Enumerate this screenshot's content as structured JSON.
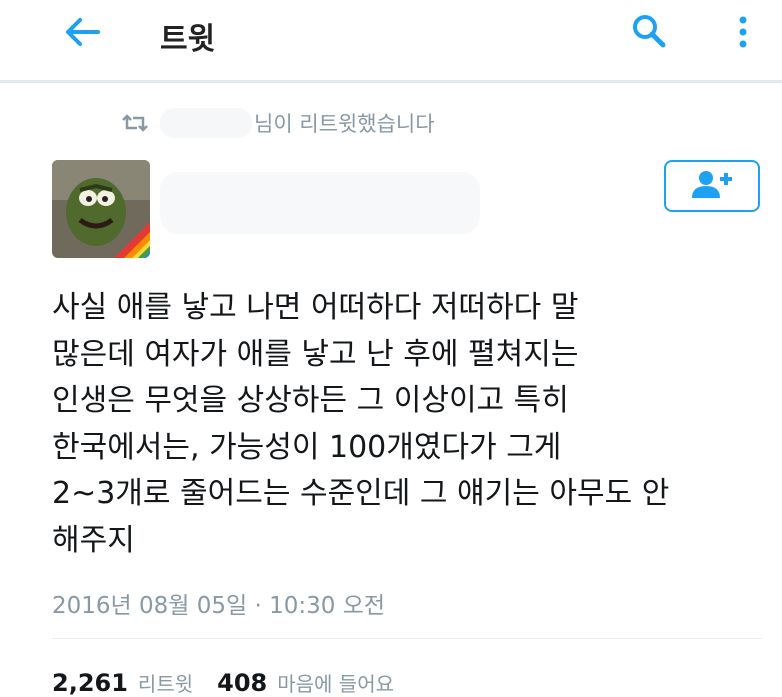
{
  "header": {
    "title": "트윗"
  },
  "retweet": {
    "label": "님이 리트윗했습니다"
  },
  "tweet": {
    "lines": [
      "사실 애를 낳고 나면 어떠하다 저떠하다 말",
      "많은데 여자가 애를 낳고 난 후에 펼쳐지는",
      "인생은 무엇을 상상하든 그 이상이고 특히",
      "한국에서는, 가능성이 100개였다가 그게",
      "2~3개로 줄어드는 수준인데 그 얘기는 아무도 안",
      "해주지"
    ],
    "timestamp": "2016년 08월 05일 · 10:30 오전"
  },
  "stats": {
    "retweets_count": "2,261",
    "retweets_label": "리트윗",
    "likes_count": "408",
    "likes_label": "마음에 들어요"
  },
  "icons": [
    "back-arrow-icon",
    "search-icon",
    "more-vertical-icon",
    "retweet-icon",
    "follow-user-icon"
  ],
  "colors": {
    "accent": "#1da1f2",
    "muted": "#8899a6",
    "text": "#14171a"
  }
}
